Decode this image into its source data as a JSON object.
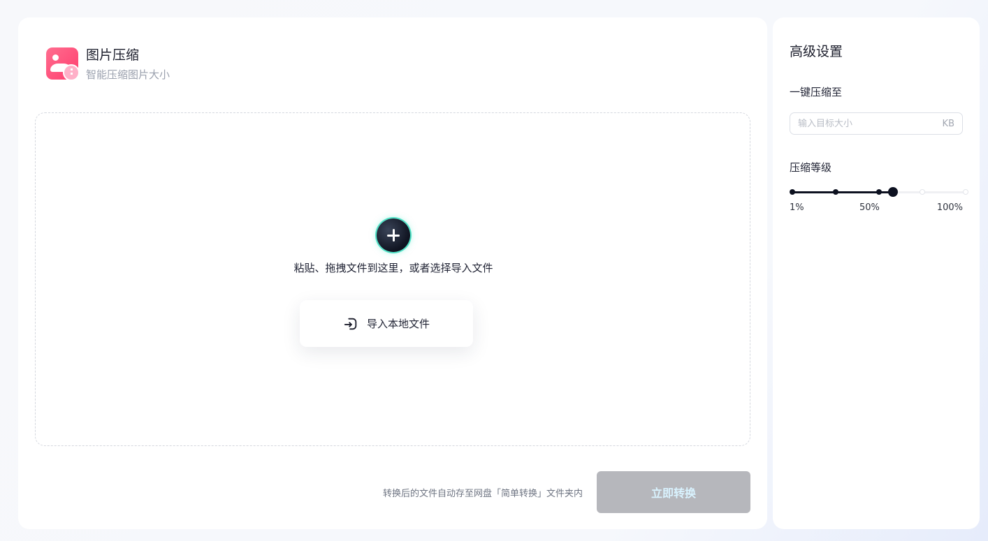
{
  "app": {
    "title": "图片压缩",
    "subtitle": "智能压缩图片大小",
    "icon": "image-compress-icon",
    "icon_color": "#ff4f7b"
  },
  "upload": {
    "add_icon": "plus-icon",
    "hint": "粘贴、拖拽文件到这里，或者选择导入文件",
    "import_button": "导入本地文件",
    "import_icon": "file-import-icon"
  },
  "footer": {
    "note": "转换后的文件自动存至网盘「简单转换」文件夹内",
    "convert_button": "立即转换",
    "convert_button_color": "#b6b7bc",
    "convert_button_text_color": "#d9f3ff"
  },
  "settings": {
    "title": "高级设置",
    "target_size": {
      "label": "一键压缩至",
      "placeholder": "输入目标大小",
      "value": "",
      "unit": "KB"
    },
    "level": {
      "label": "压缩等级",
      "value_percent": 58,
      "stops": [
        0,
        25,
        50,
        58,
        75,
        100
      ],
      "labels": {
        "min": "1%",
        "mid": "50%",
        "max": "100%"
      },
      "fill_color": "#0d1120"
    }
  }
}
